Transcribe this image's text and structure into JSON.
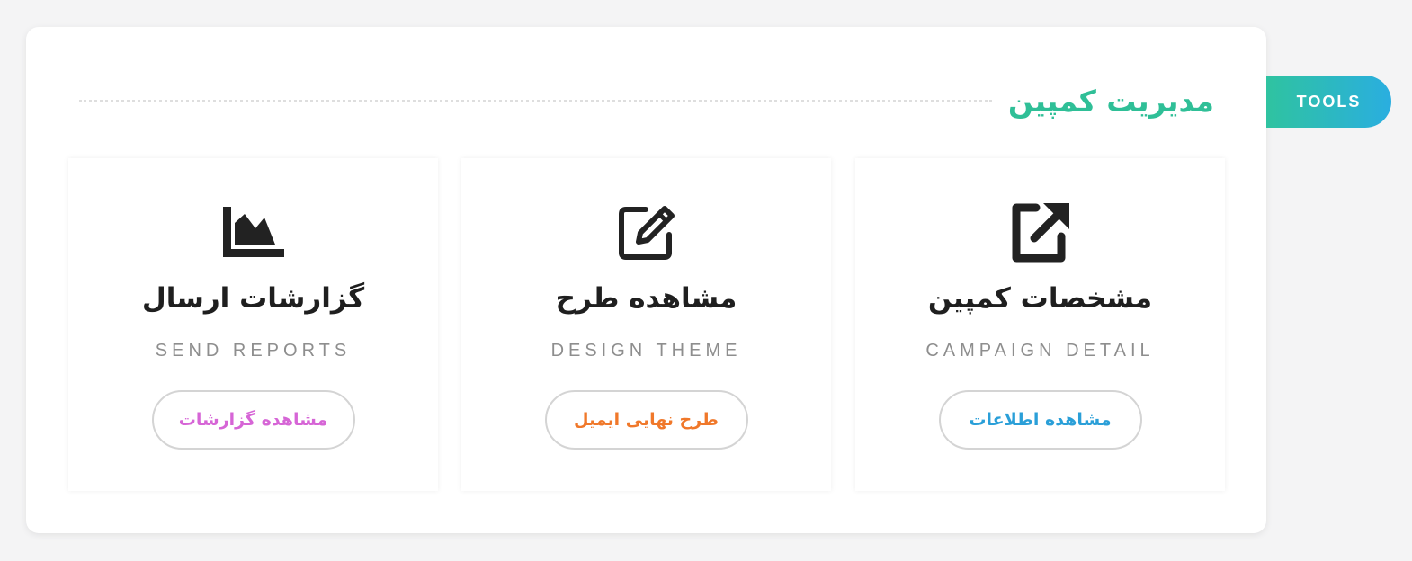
{
  "tools_tab": {
    "label": "TOOLS"
  },
  "header": {
    "title": "مدیریت کمپین"
  },
  "colors": {
    "accent_green": "#2fbf97",
    "tab_gradient_start": "#2fc3a0",
    "tab_gradient_end": "#2aaee0"
  },
  "cards": [
    {
      "icon": "external-link-icon",
      "title": "مشخصات کمپین",
      "subtitle": "CAMPAIGN DETAIL",
      "button_label": "مشاهده اطلاعات",
      "button_color": "#2a9fd8"
    },
    {
      "icon": "edit-icon",
      "title": "مشاهده طرح",
      "subtitle": "DESIGN THEME",
      "button_label": "طرح نهایی ایمیل",
      "button_color": "#f0782a"
    },
    {
      "icon": "area-chart-icon",
      "title": "گزارشات ارسال",
      "subtitle": "SEND REPORTS",
      "button_label": "مشاهده گزارشات",
      "button_color": "#d665d6"
    }
  ]
}
